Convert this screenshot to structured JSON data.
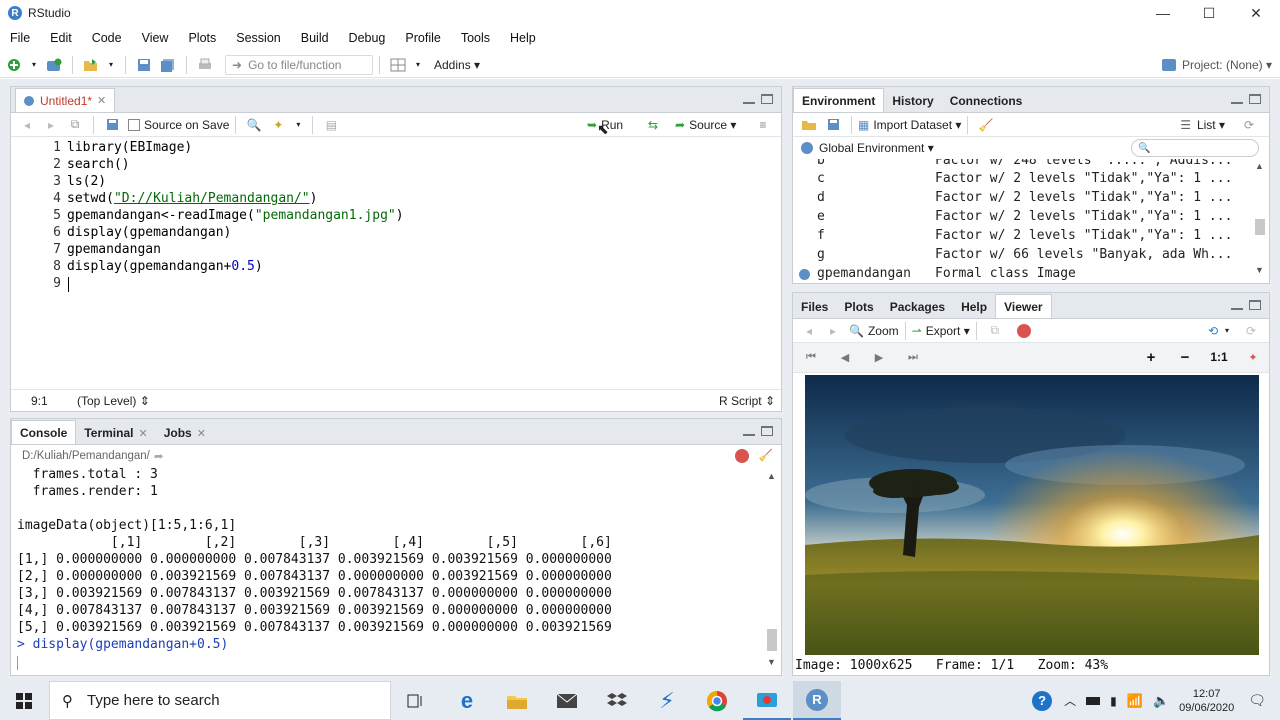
{
  "window": {
    "title": "RStudio",
    "app_icon_letter": "R",
    "minimize": "—",
    "maximize": "☐",
    "close": "✕"
  },
  "menus": [
    "File",
    "Edit",
    "Code",
    "View",
    "Plots",
    "Session",
    "Build",
    "Debug",
    "Profile",
    "Tools",
    "Help"
  ],
  "toolbar": {
    "goto_placeholder": "Go to file/function",
    "addins": "Addins",
    "project": "Project: (None)"
  },
  "editor": {
    "tab_label": "Untitled1*",
    "source_on_save": "Source on Save",
    "run": "Run",
    "source": "Source",
    "lines": [
      {
        "n": "1",
        "code": "library(EBImage)"
      },
      {
        "n": "2",
        "code": "search()"
      },
      {
        "n": "3",
        "code": "ls(2)"
      },
      {
        "n": "4",
        "pre": "setwd(",
        "str": "\"D://Kuliah/Pemandangan/\"",
        "post": ")"
      },
      {
        "n": "5",
        "pre": "gpemandangan<-readImage(",
        "str": "\"pemandangan1.jpg\"",
        "post": ")"
      },
      {
        "n": "6",
        "code": "display(gpemandangan)"
      },
      {
        "n": "7",
        "code": "gpemandangan"
      },
      {
        "n": "8",
        "pre": "display(gpemandangan+",
        "numv": "0.5",
        "post": ")"
      },
      {
        "n": "9",
        "code": ""
      }
    ],
    "status_pos": "9:1",
    "status_scope": "(Top Level) ⇕",
    "status_lang": "R Script ⇕"
  },
  "console": {
    "tabs": [
      "Console",
      "Terminal",
      "Jobs"
    ],
    "path": "D:/Kuliah/Pemandangan/",
    "lines": [
      "  frames.total : 3",
      "  frames.render: 1",
      "",
      "imageData(object)[1:5,1:6,1]",
      "            [,1]        [,2]        [,3]        [,4]        [,5]        [,6]",
      "[1,] 0.000000000 0.000000000 0.007843137 0.003921569 0.003921569 0.000000000",
      "[2,] 0.000000000 0.003921569 0.007843137 0.000000000 0.003921569 0.000000000",
      "[3,] 0.003921569 0.007843137 0.003921569 0.007843137 0.000000000 0.000000000",
      "[4,] 0.007843137 0.007843137 0.003921569 0.003921569 0.000000000 0.000000000",
      "[5,] 0.003921569 0.003921569 0.007843137 0.003921569 0.000000000 0.003921569"
    ],
    "command": "> display(gpemandangan+0.5)"
  },
  "environment": {
    "tabs": [
      "Environment",
      "History",
      "Connections"
    ],
    "import_dataset": "Import Dataset",
    "list": "List",
    "scope": "Global Environment",
    "rows": [
      {
        "name": "b",
        "value": "Factor w/ 248 levels  ..... , Addis..."
      },
      {
        "name": "c",
        "value": "Factor w/ 2 levels \"Tidak\",\"Ya\": 1 ..."
      },
      {
        "name": "d",
        "value": "Factor w/ 2 levels \"Tidak\",\"Ya\": 1 ..."
      },
      {
        "name": "e",
        "value": "Factor w/ 2 levels \"Tidak\",\"Ya\": 1 ..."
      },
      {
        "name": "f",
        "value": "Factor w/ 2 levels \"Tidak\",\"Ya\": 1 ..."
      },
      {
        "name": "g",
        "value": "Factor w/ 66 levels \"Banyak, ada Wh..."
      },
      {
        "name": "gpemandangan",
        "value": "Formal class Image"
      }
    ]
  },
  "files": {
    "tabs": [
      "Files",
      "Plots",
      "Packages",
      "Help",
      "Viewer"
    ],
    "zoom": "Zoom",
    "export": "Export",
    "zoom_in": "+",
    "zoom_out": "−",
    "one_to_one": "1:1",
    "image_status": "Image: 1000x625   Frame: 1/1   Zoom: 43%"
  },
  "taskbar": {
    "search_placeholder": "Type here to search",
    "time": "12:07",
    "date": "09/06/2020"
  }
}
